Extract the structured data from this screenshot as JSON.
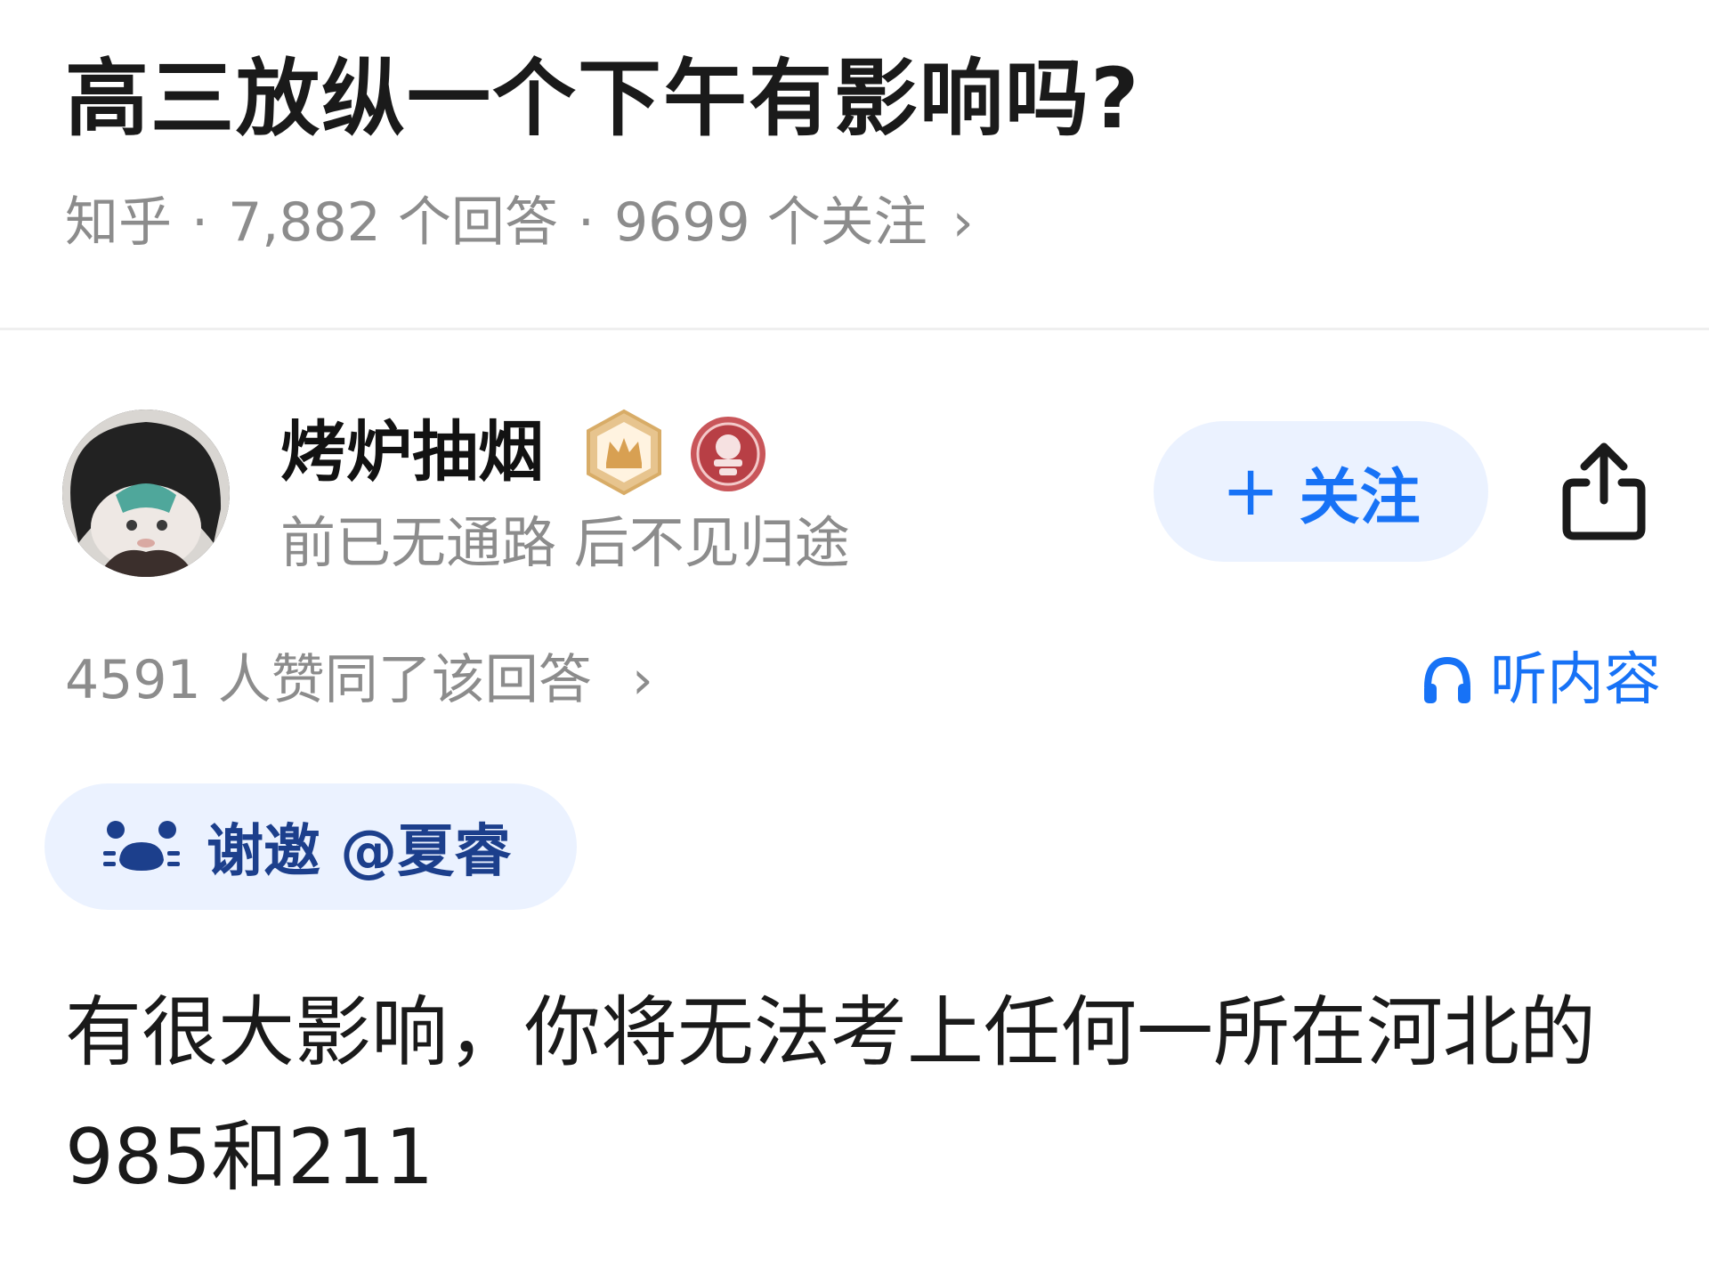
{
  "question": {
    "title": "高三放纵一个下午有影响吗?",
    "source": "知乎",
    "separator": "·",
    "answers": "7,882 个回答",
    "followers": "9699 个关注",
    "chevron": "›"
  },
  "author": {
    "name": "烤炉抽烟",
    "bio": "前已无通路 后不见归途",
    "badges": [
      "crown-badge-icon",
      "seal-badge-icon"
    ]
  },
  "actions": {
    "follow_plus": "+",
    "follow_label": "关注",
    "share_icon": "share-icon"
  },
  "answer": {
    "votes": "4591 人赞同了该回答",
    "chevron": "›",
    "listen_label": "听内容",
    "invite_label": "谢邀 @夏睿",
    "body": "有很大影响，你将无法考上任何一所在河北的985和211"
  },
  "colors": {
    "accent": "#1772f6",
    "chip_bg": "#ebf2ff",
    "muted": "#8c8c8c",
    "invite_text": "#1c3f8c"
  }
}
